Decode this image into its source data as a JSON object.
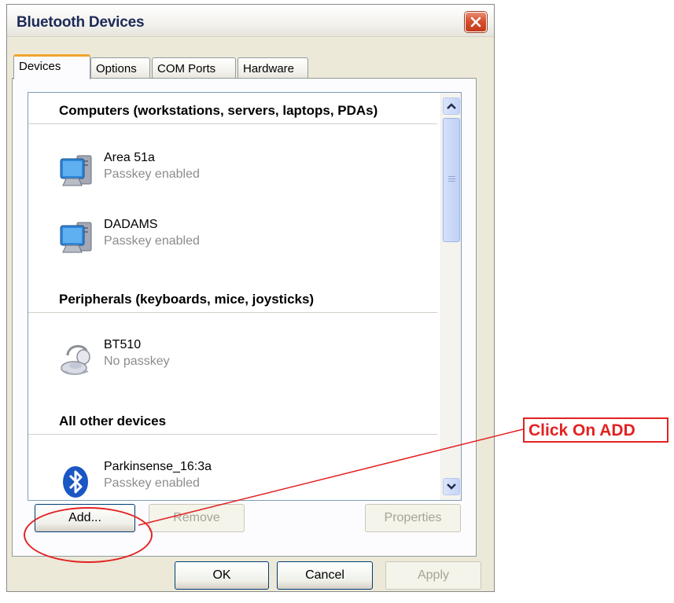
{
  "window": {
    "title": "Bluetooth Devices",
    "close_icon": "close-icon"
  },
  "tabs": [
    {
      "label": "Devices",
      "active": true
    },
    {
      "label": "Options",
      "active": false
    },
    {
      "label": "COM Ports",
      "active": false
    },
    {
      "label": "Hardware",
      "active": false
    }
  ],
  "device_list": {
    "groups": [
      {
        "header": "Computers (workstations, servers, laptops, PDAs)",
        "devices": [
          {
            "name": "Area 51a",
            "status": "Passkey enabled",
            "icon": "computer-icon"
          },
          {
            "name": "DADAMS",
            "status": "Passkey enabled",
            "icon": "computer-icon"
          }
        ]
      },
      {
        "header": "Peripherals (keyboards, mice, joysticks)",
        "devices": [
          {
            "name": "BT510",
            "status": "No passkey",
            "icon": "headset-icon"
          }
        ]
      },
      {
        "header": "All other devices",
        "devices": [
          {
            "name": "Parkinsense_16:3a",
            "status": "Passkey enabled",
            "icon": "bluetooth-icon"
          }
        ]
      }
    ]
  },
  "buttons": {
    "add": "Add...",
    "remove": "Remove",
    "properties": "Properties",
    "ok": "OK",
    "cancel": "Cancel",
    "apply": "Apply"
  },
  "annotation": {
    "label": "Click On ADD",
    "color": "#e22222"
  },
  "colors": {
    "dialog_bg": "#ece9d8",
    "active_tab_accent": "#f3a430",
    "list_border": "#7f9db9",
    "button_border": "#003c74"
  }
}
